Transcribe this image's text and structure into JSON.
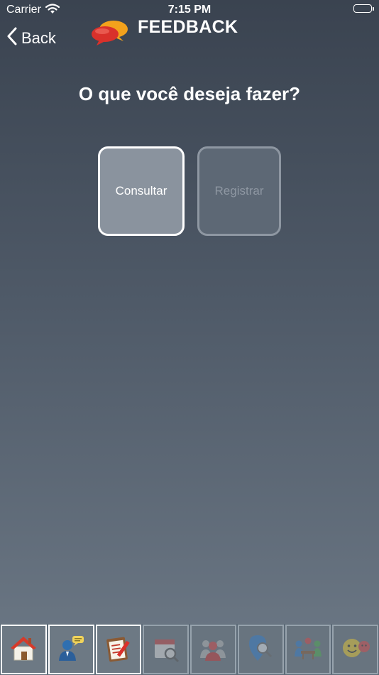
{
  "status_bar": {
    "carrier": "Carrier",
    "time": "7:15 PM"
  },
  "nav": {
    "back_label": "Back",
    "title": "FEEDBACK"
  },
  "question": "O que você deseja fazer?",
  "actions": {
    "consultar": "Consultar",
    "registrar": "Registrar"
  },
  "tabs": [
    {
      "icon": "house-icon",
      "active": true
    },
    {
      "icon": "person-speech-icon",
      "active": true
    },
    {
      "icon": "clipboard-pencil-icon",
      "active": true
    },
    {
      "icon": "calendar-search-icon",
      "active": false
    },
    {
      "icon": "group-icon",
      "active": false
    },
    {
      "icon": "location-search-icon",
      "active": false
    },
    {
      "icon": "meeting-icon",
      "active": false
    },
    {
      "icon": "smiley-icon",
      "active": false
    }
  ],
  "colors": {
    "background_top": "#3a4350",
    "background_bottom": "#6d7986",
    "logo_red": "#d9312b",
    "logo_orange": "#f3a21c"
  }
}
